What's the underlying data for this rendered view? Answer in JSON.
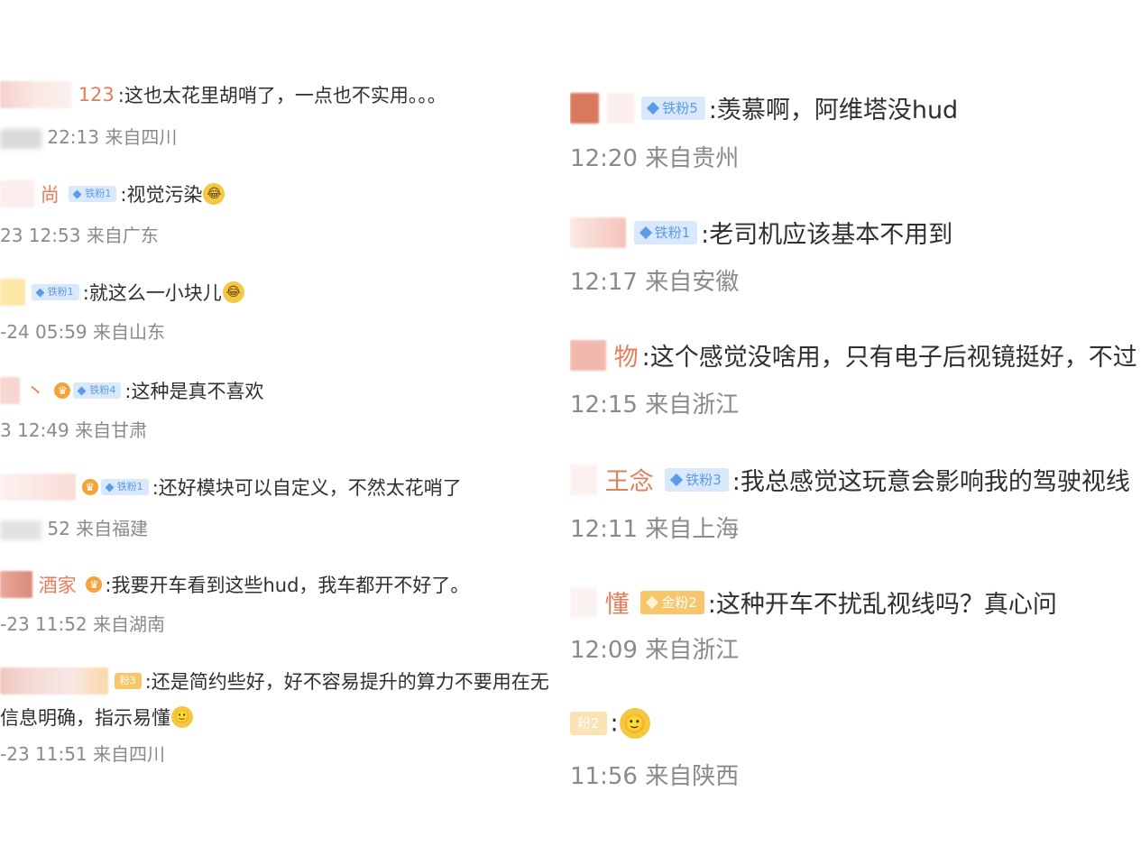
{
  "left_comments": [
    {
      "name": "123",
      "badge": "",
      "text": ":这也太花里胡哨了，一点也不实用。。。",
      "emoji": "",
      "time": "22:13",
      "location": "来自四川"
    },
    {
      "name": "尚",
      "badge": "铁粉1",
      "text": ":视觉污染",
      "emoji": "😂",
      "time": "23 12:53",
      "location": "来自广东"
    },
    {
      "name": "",
      "badge": "铁粉1",
      "text": ":就这么一小块儿",
      "emoji": "😂",
      "time": "-24 05:59",
      "location": "来自山东"
    },
    {
      "name": "丶",
      "badge": "铁粉4",
      "crown": true,
      "text": ":这种是真不喜欢",
      "emoji": "",
      "time": "3 12:49",
      "location": "来自甘肃"
    },
    {
      "name": "",
      "badge": "铁粉1",
      "crown": true,
      "text": ":还好模块可以自定义，不然太花哨了",
      "emoji": "",
      "time": "52",
      "location": "来自福建"
    },
    {
      "name": "酒家",
      "badge": "",
      "crown": true,
      "text": ":我要开车看到这些hud，我车都开不好了。",
      "emoji": "",
      "time": "-23 11:52",
      "location": "来自湖南"
    },
    {
      "name": "",
      "badge": "粉3",
      "text": ":还是简约些好，好不容易提升的算力不要用在无",
      "continuation": "信息明确，指示易懂",
      "emoji": "🙂",
      "time": "-23 11:51",
      "location": "来自四川"
    }
  ],
  "right_comments": [
    {
      "name": "",
      "badge": "铁粉5",
      "text": ":羡慕啊，阿维塔没hud",
      "emoji": "",
      "time": "12:20",
      "location": "来自贵州"
    },
    {
      "name": "",
      "badge": "铁粉1",
      "text": ":老司机应该基本不用到",
      "emoji": "",
      "time": "12:17",
      "location": "来自安徽"
    },
    {
      "name": "物",
      "badge": "",
      "text": ":这个感觉没啥用，只有电子后视镜挺好，不过",
      "emoji": "",
      "time": "12:15",
      "location": "来自浙江"
    },
    {
      "name": "王念",
      "badge": "铁粉3",
      "text": ":我总感觉这玩意会影响我的驾驶视线",
      "emoji": "",
      "time": "12:11",
      "location": "来自上海"
    },
    {
      "name": "懂",
      "badge": "金粉2",
      "gold": true,
      "text": ":这种开车不扰乱视线吗？真心问",
      "emoji": "",
      "time": "12:09",
      "location": "来自浙江"
    },
    {
      "name": "",
      "badge": "粉2",
      "gold": true,
      "text": ":",
      "emoji": "🙂",
      "time": "11:56",
      "location": "来自陕西"
    }
  ]
}
